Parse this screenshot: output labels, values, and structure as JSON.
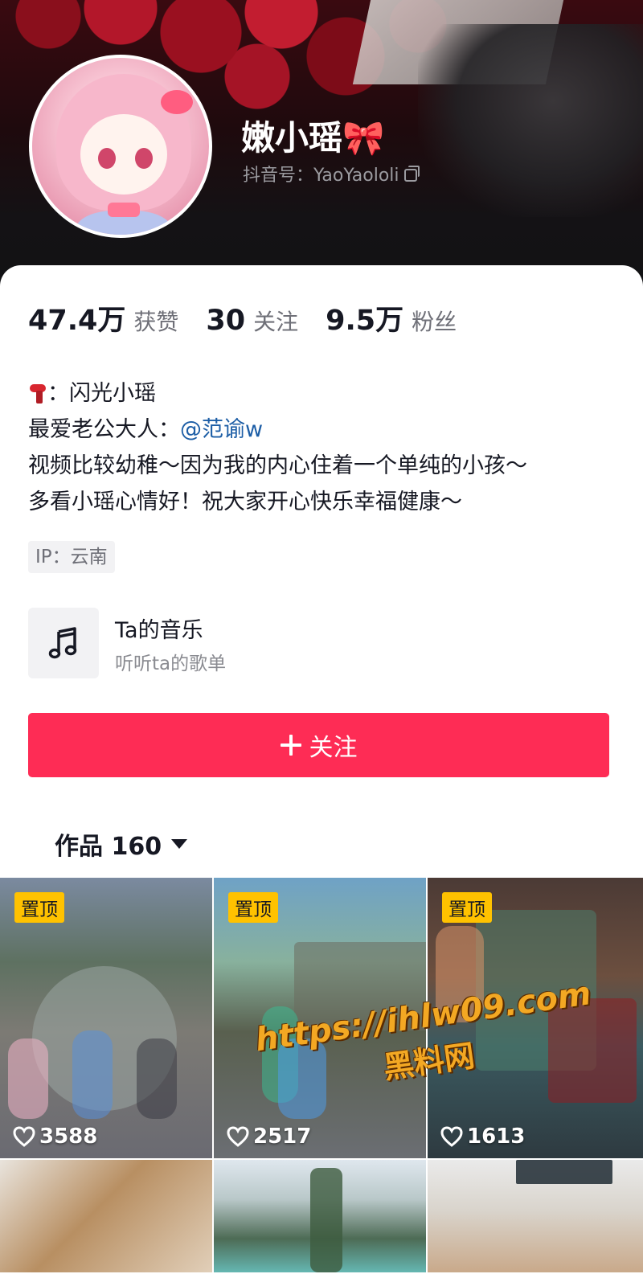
{
  "profile": {
    "nickname": "嫩小瑶🎀",
    "douyin_id": "抖音号：YaoYaololi"
  },
  "stats": [
    {
      "value": "47.4万",
      "label": "获赞"
    },
    {
      "value": "30",
      "label": "关注"
    },
    {
      "value": "9.5万",
      "label": "粉丝"
    }
  ],
  "bio": {
    "line1": "：闪光小瑶",
    "line2_prefix": "最爱老公大人：",
    "line2_mention": "@范谕w",
    "line3": "视频比较幼稚～因为我的内心住着一个单纯的小孩～",
    "line4": "多看小瑶心情好！祝大家开心快乐幸福健康～"
  },
  "ip": "IP：云南",
  "music": {
    "title": "Ta的音乐",
    "subtitle": "听听ta的歌单"
  },
  "follow_button": "关注",
  "works_tab": "作品 160",
  "videos": [
    {
      "pinned": "置顶",
      "likes": "3588"
    },
    {
      "pinned": "置顶",
      "likes": "2517"
    },
    {
      "pinned": "置顶",
      "likes": "1613"
    }
  ],
  "watermark": {
    "url": "https://ihlw09.com",
    "site": "黑料网"
  },
  "colors": {
    "accent": "#fe2c55",
    "mention": "#1d5ea6",
    "pin_badge": "#ffc200"
  }
}
